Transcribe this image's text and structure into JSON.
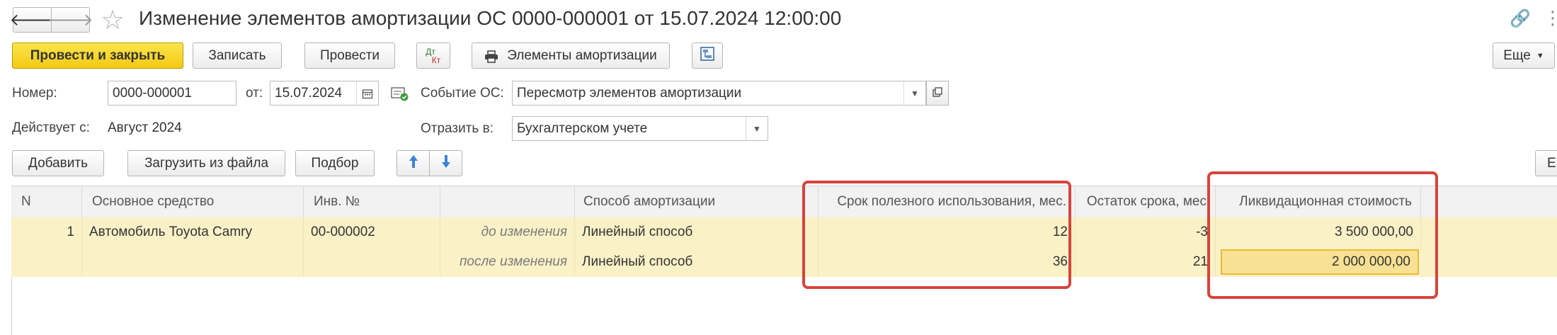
{
  "header": {
    "title": "Изменение элементов амортизации ОС 0000-000001 от 15.07.2024 12:00:00",
    "back_glyph": "🡐",
    "forward_glyph": "🡒",
    "star_glyph": "☆",
    "link_glyph": "🔗",
    "more_glyph": "⋮"
  },
  "toolbar": {
    "post_close": "Провести и закрыть",
    "save": "Записать",
    "post": "Провести",
    "dtkt_top": "Дт",
    "dtkt_bottom": "Кт",
    "print_elements": "Элементы амортизации",
    "more": "Еще"
  },
  "form": {
    "number_label": "Номер:",
    "number_value": "0000-000001",
    "date_label": "от:",
    "date_value": "15.07.2024",
    "event_label": "Событие ОС:",
    "event_value": "Пересмотр элементов амортизации",
    "effective_label": "Действует с:",
    "effective_value": "Август 2024",
    "reflect_label": "Отразить в:",
    "reflect_value": "Бухгалтерском учете"
  },
  "table_toolbar": {
    "add": "Добавить",
    "load_file": "Загрузить из файла",
    "select": "Подбор",
    "right_cut": "Е"
  },
  "table": {
    "columns": [
      "N",
      "Основное средство",
      "Инв. №",
      "",
      "Способ амортизации",
      "Срок полезного использования, мес.",
      "Остаток срока, мес",
      "Ликвидационная стоимость"
    ],
    "rows": [
      {
        "n": "1",
        "asset": "Автомобиль Toyota Camry",
        "inv": "00-000002",
        "state": "до изменения",
        "method": "Линейный способ",
        "life": "12",
        "remaining": "-3",
        "liquidation": "3 500 000,00"
      },
      {
        "n": "",
        "asset": "",
        "inv": "",
        "state": "после изменения",
        "method": "Линейный способ",
        "life": "36",
        "remaining": "21",
        "liquidation": "2 000 000,00"
      }
    ]
  },
  "colors": {
    "accent": "#f3c915",
    "row_bg": "#fbf1c7",
    "highlight": "#d6443c"
  }
}
